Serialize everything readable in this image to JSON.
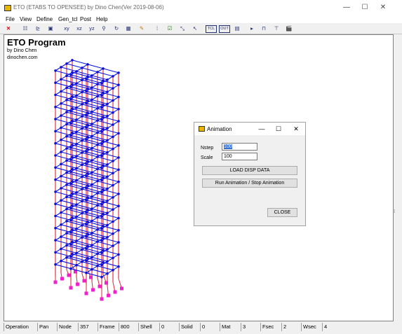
{
  "window": {
    "title": "ETO (ETABS TO OPENSEE) by Dino Chen(Ver 2019-08-06)",
    "controls": {
      "minimize": "—",
      "maximize": "☐",
      "close": "✕"
    }
  },
  "menu": [
    "File",
    "View",
    "Define",
    "Gen_tcl",
    "Post",
    "Help"
  ],
  "toolbar": {
    "items": [
      {
        "icon": "close-x-icon",
        "glyph": "✕"
      },
      {
        "icon": "define-icon",
        "glyph": "☷"
      },
      {
        "icon": "chart-icon",
        "glyph": "⊵"
      },
      {
        "icon": "save-icon",
        "glyph": "▣"
      },
      {
        "icon": "view-xy-icon",
        "glyph": "xy"
      },
      {
        "icon": "view-xz-icon",
        "glyph": "xz"
      },
      {
        "icon": "view-yz-icon",
        "glyph": "yz"
      },
      {
        "icon": "zoom-icon",
        "glyph": "⚲"
      },
      {
        "icon": "rotate-icon",
        "glyph": "↻"
      },
      {
        "icon": "display-icon",
        "glyph": "▦"
      },
      {
        "icon": "pen-icon",
        "glyph": "✎"
      },
      {
        "icon": "node-icon",
        "glyph": "⁞"
      },
      {
        "icon": "check-icon",
        "glyph": "☑"
      },
      {
        "icon": "deform-icon",
        "glyph": "⤡"
      },
      {
        "icon": "pointer-icon",
        "glyph": "↖"
      },
      {
        "icon": "tcl-icon",
        "glyph": "TCL"
      },
      {
        "icon": "output-icon",
        "glyph": "OUT"
      },
      {
        "icon": "document-icon",
        "glyph": "▤"
      },
      {
        "icon": "play-icon",
        "glyph": "▸"
      },
      {
        "icon": "frame-icon",
        "glyph": "⊓"
      },
      {
        "icon": "frame2-icon",
        "glyph": "⊤"
      },
      {
        "icon": "animation-icon",
        "glyph": "🎬"
      }
    ]
  },
  "canvas": {
    "heading": "ETO Program",
    "author": "by Dino Chen",
    "website": "dinochen.com"
  },
  "colors": {
    "beams": "#0a14e6",
    "columns": "#e0203a",
    "nodes": "#1010d8",
    "supports": "#ee22cc"
  },
  "animation_dialog": {
    "title": "Animation",
    "nstep_label": "Nstep",
    "nstep_value": "100",
    "scale_label": "Scale",
    "scale_value": "100",
    "load_button": "LOAD DISP DATA",
    "run_button": "Run Animation / Stop Animation",
    "close_button": "CLOSE"
  },
  "status_bar": [
    {
      "label": "Operation",
      "value": "Pan"
    },
    {
      "label": "Node",
      "value": "357"
    },
    {
      "label": "Frame",
      "value": "800"
    },
    {
      "label": "Shell",
      "value": "0"
    },
    {
      "label": "Solid",
      "value": "0"
    },
    {
      "label": "Mat",
      "value": "3"
    },
    {
      "label": "Fsec",
      "value": "2"
    },
    {
      "label": "Wsec",
      "value": "4"
    }
  ]
}
